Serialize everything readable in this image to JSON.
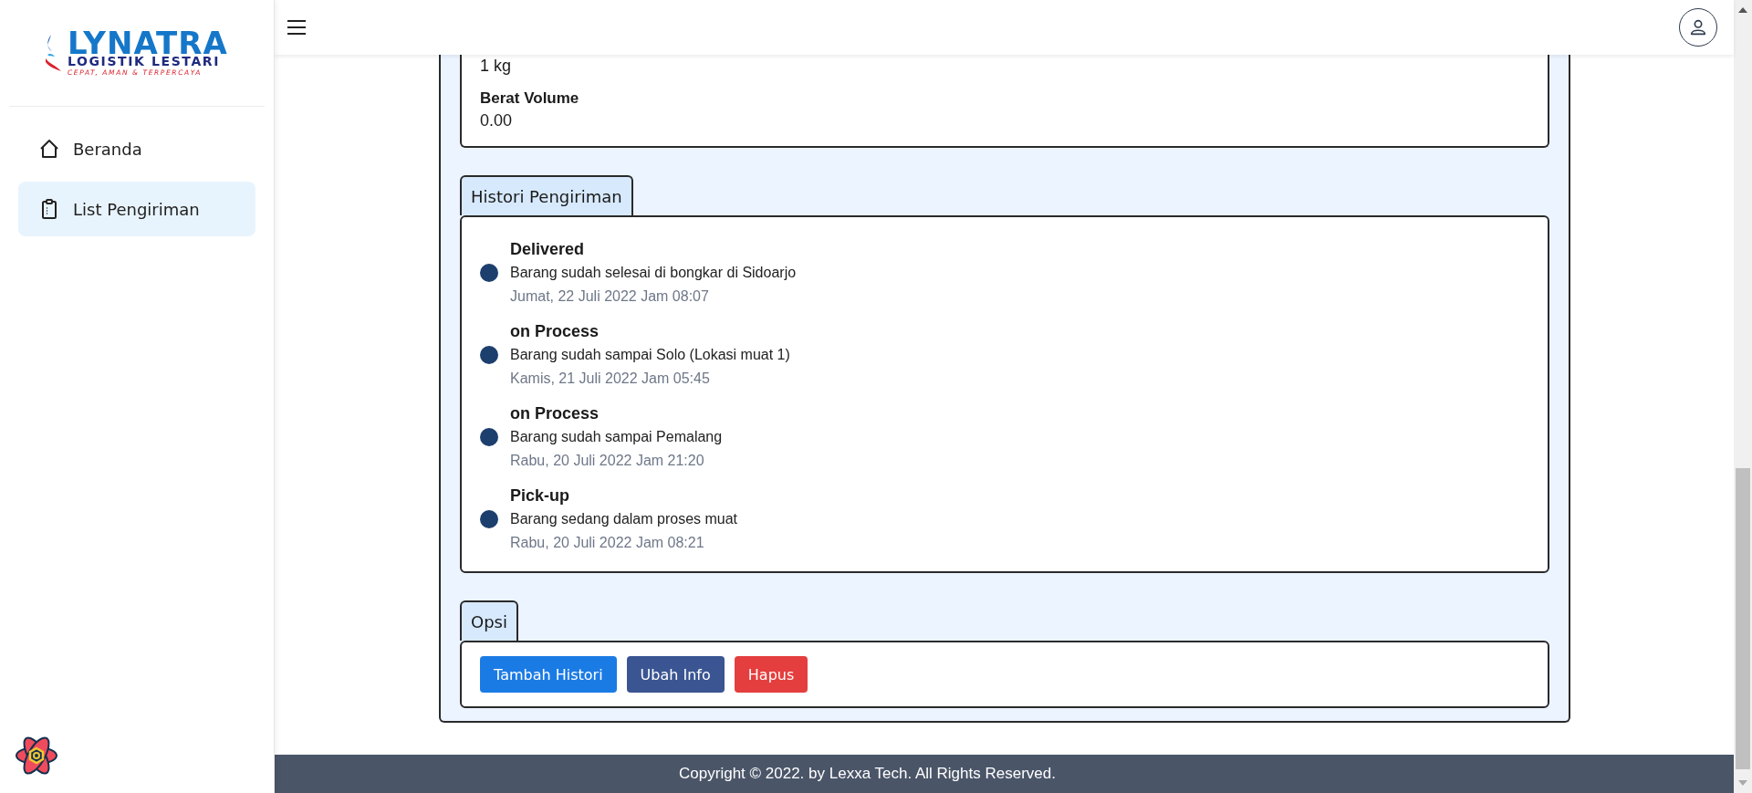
{
  "logo": {
    "name": "LYNATRA",
    "subtitle": "LOGISTIK LESTARI",
    "tagline": "CEPAT, AMAN & TERPERCAYA"
  },
  "sidebar": {
    "items": [
      {
        "label": "Beranda",
        "kind": "home",
        "selected": false
      },
      {
        "label": "List Pengiriman",
        "kind": "clipboard",
        "selected": true
      }
    ]
  },
  "info": {
    "fields": [
      {
        "value": "1 kg"
      },
      {
        "label": "Berat Volume",
        "value": "0.00"
      }
    ]
  },
  "history": {
    "title": "Histori Pengiriman",
    "entries": [
      {
        "status": "Delivered",
        "description": "Barang sudah selesai di bongkar di Sidoarjo",
        "time": "Jumat, 22 Juli 2022 Jam 08:07"
      },
      {
        "status": "on Process",
        "description": "Barang sudah sampai Solo (Lokasi muat 1)",
        "time": "Kamis, 21 Juli 2022 Jam 05:45"
      },
      {
        "status": "on Process",
        "description": "Barang sudah sampai Pemalang",
        "time": "Rabu, 20 Juli 2022 Jam 21:20"
      },
      {
        "status": "Pick-up",
        "description": "Barang sedang dalam proses muat",
        "time": "Rabu, 20 Juli 2022 Jam 08:21"
      }
    ]
  },
  "options": {
    "title": "Opsi",
    "buttons": [
      {
        "label": "Tambah Histori",
        "kind": "primary"
      },
      {
        "label": "Ubah Info",
        "kind": "secondary"
      },
      {
        "label": "Hapus",
        "kind": "danger"
      }
    ]
  },
  "footer": {
    "text": "Copyright © 2022. by Lexxa Tech. All Rights Reserved."
  }
}
